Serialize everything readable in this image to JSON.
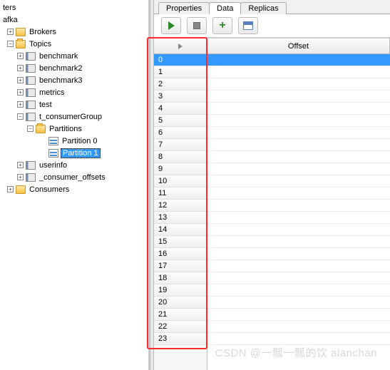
{
  "tabs": {
    "properties": "Properties",
    "data": "Data",
    "replicas": "Replicas",
    "active": "Data"
  },
  "column_header": "Offset",
  "tree": {
    "root1": "ters",
    "root2": "afka",
    "brokers": "Brokers",
    "topics": "Topics",
    "benchmark": "benchmark",
    "benchmark2": "benchmark2",
    "benchmark3": "benchmark3",
    "metrics": "metrics",
    "test": "test",
    "t_consumerGroup": "t_consumerGroup",
    "partitions": "Partitions",
    "partition0": "Partition 0",
    "partition1": "Partition 1",
    "userinfo": "userinfo",
    "consumer_offsets": "_consumer_offsets",
    "consumers": "Consumers"
  },
  "chart_data": {
    "type": "table",
    "title": "Offset",
    "values": [
      0,
      1,
      2,
      3,
      4,
      5,
      6,
      7,
      8,
      9,
      10,
      11,
      12,
      13,
      14,
      15,
      16,
      17,
      18,
      19,
      20,
      21,
      22,
      23
    ],
    "selected_index": 0
  },
  "watermark": "CSDN @一瓢一瓢的饮 alanchan"
}
